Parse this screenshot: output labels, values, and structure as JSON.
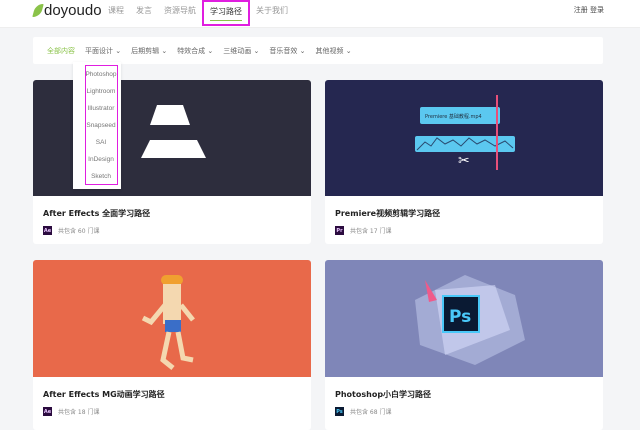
{
  "header": {
    "logo": "doyoudo",
    "nav": [
      "课程",
      "发言",
      "资源导航",
      "学习路径",
      "关于我们"
    ],
    "active_nav": "学习路径",
    "auth": "注册 登录"
  },
  "filter": {
    "items": [
      "全部内容",
      "平面设计 ⌄",
      "后期剪辑 ⌄",
      "特效合成 ⌄",
      "三维动画 ⌄",
      "音乐音效 ⌄",
      "其他视频 ⌄"
    ],
    "active": "全部内容"
  },
  "dropdown": {
    "items": [
      "Photoshop",
      "Lightroom",
      "Illustrator",
      "Snapseed",
      "SAI",
      "InDesign",
      "Sketch"
    ]
  },
  "cards": [
    {
      "title": "After Effects 全面学习路径",
      "badge": "Ae",
      "meta": "共包含 60 门课",
      "bg": "#2d2d3d"
    },
    {
      "title": "Premiere视频剪辑学习路径",
      "badge": "Pr",
      "meta": "共包含 17 门课",
      "bg": "#252750",
      "clip_label": "Premiere 基础教程.mp4"
    },
    {
      "title": "After Effects MG动画学习路径",
      "badge": "Ae",
      "meta": "共包含 18 门课",
      "bg": "#e8694a"
    },
    {
      "title": "Photoshop小白学习路径",
      "badge": "Ps",
      "meta": "共包含 68 门课",
      "bg": "#7f86b8"
    }
  ]
}
